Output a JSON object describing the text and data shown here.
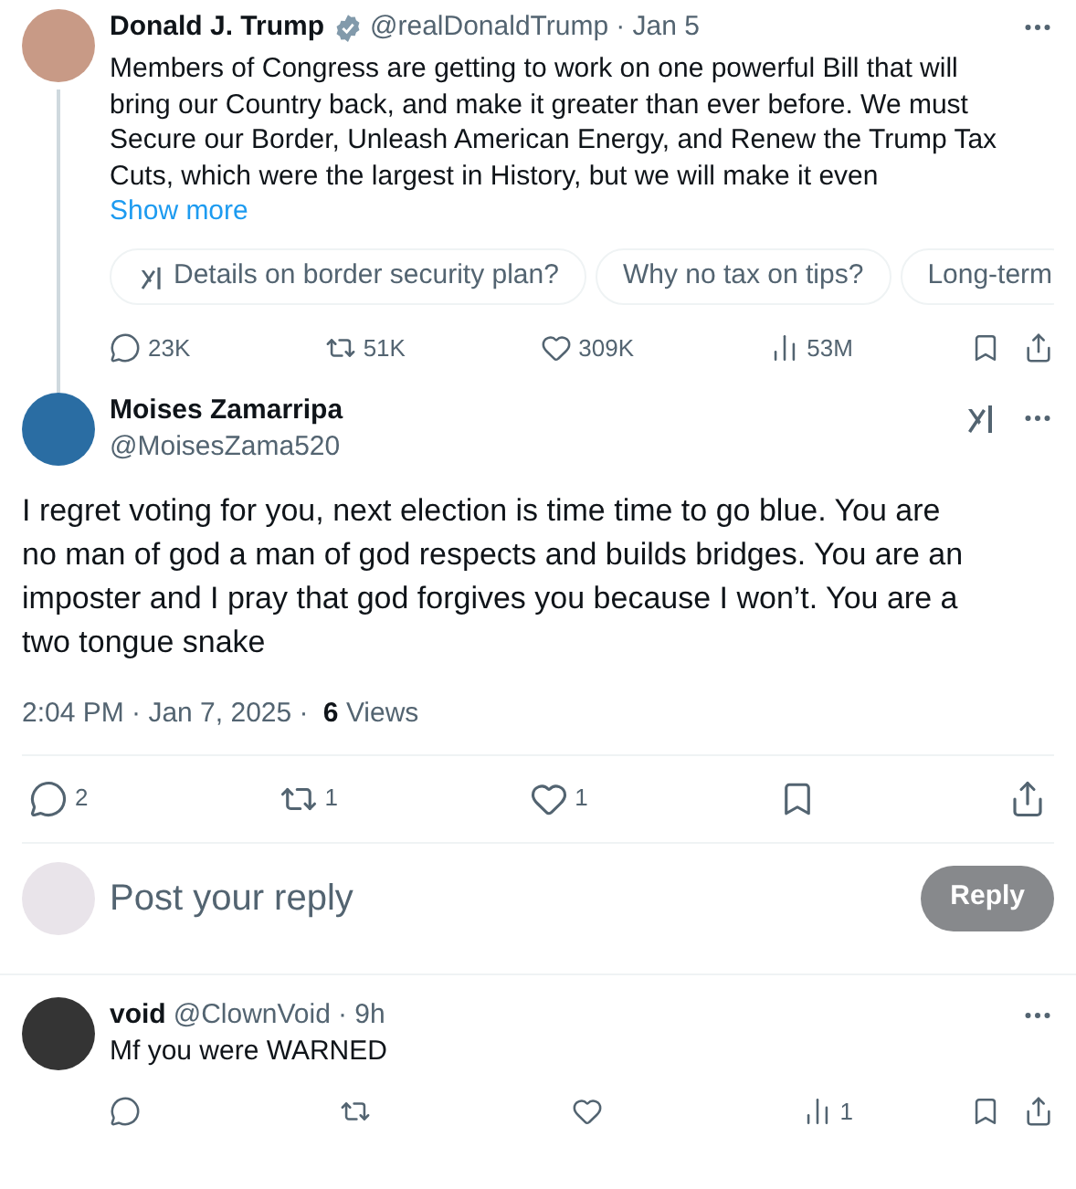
{
  "parent_post": {
    "author": "Donald J. Trump",
    "verified": true,
    "handle": "@realDonaldTrump",
    "time": "· Jan 5",
    "text": "Members of Congress are getting to work on one powerful Bill that will bring our Country back, and make it greater than ever before. We must Secure our Border, Unleash American Energy, and Renew the Trump Tax Cuts, which were the largest in History, but we will make it even",
    "show_more": "Show more",
    "suggestions": [
      {
        "label": "Details on border security plan?",
        "kind": "grok"
      },
      {
        "label": "Why no tax on tips?",
        "kind": "plain"
      },
      {
        "label": "Long-term",
        "kind": "plain"
      }
    ],
    "actions": [
      {
        "kind": "reply",
        "count": "23K"
      },
      {
        "kind": "repost",
        "count": "51K"
      },
      {
        "kind": "like",
        "count": "309K"
      },
      {
        "kind": "views",
        "count": "53M"
      },
      {
        "kind": "bookmark"
      },
      {
        "kind": "share"
      }
    ]
  },
  "main_post": {
    "author": "Moises Zamarripa",
    "handle": "@MoisesZama520",
    "text": "I regret voting for you, next election is time time to go blue. You are no man of god a man of god respects and builds bridges. You are an imposter and I pray that god forgives you because I won’t.  You are a two tongue snake",
    "timestamp": "2:04 PM · Jan 7, 2025 · ",
    "views_count": "6",
    "views_label": "Views",
    "actions": [
      {
        "kind": "reply",
        "count": "2"
      },
      {
        "kind": "repost",
        "count": "1"
      },
      {
        "kind": "like",
        "count": "1"
      },
      {
        "kind": "bookmark"
      },
      {
        "kind": "share"
      }
    ]
  },
  "composer": {
    "placeholder": "Post your reply",
    "button": "Reply",
    "disabled": true
  },
  "replies": [
    {
      "author": "void",
      "handle": "@ClownVoid",
      "time": "· 9h",
      "text": "Mf you were WARNED",
      "actions": [
        {
          "kind": "reply"
        },
        {
          "kind": "repost"
        },
        {
          "kind": "like"
        },
        {
          "kind": "views",
          "count": "1"
        },
        {
          "kind": "bookmark"
        },
        {
          "kind": "share"
        }
      ]
    }
  ]
}
